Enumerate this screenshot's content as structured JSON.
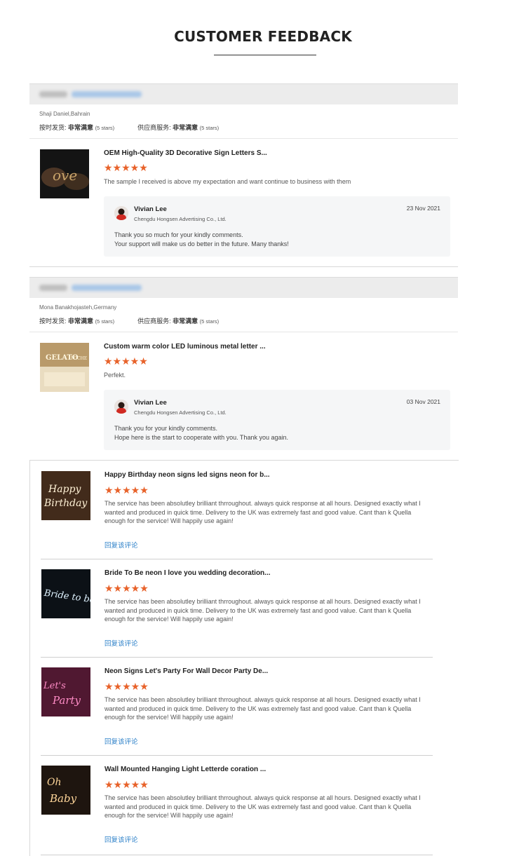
{
  "header": {
    "title": "CUSTOMER FEEDBACK"
  },
  "orders": [
    {
      "buyer": "Shaji Daniel,Bahrain",
      "delivery_label": "按时发货:",
      "delivery_value": "非常满意",
      "delivery_stars": "(5 stars)",
      "service_label": "供应商服务:",
      "service_value": "非常满意",
      "service_stars": "(5 stars)",
      "product_title": "OEM High-Quality 3D Decorative Sign Letters S...",
      "stars": "★★★★★",
      "review": "The sample I received is above my expectation and want continue to business with them",
      "reply": {
        "name": "Vivian Lee",
        "company": "Chengdu Hongsen Advertising Co., Ltd.",
        "date": "23 Nov 2021",
        "line1": "Thank you so much for your kindly comments.",
        "line2": "Your support will make us do better in the future. Many thanks!"
      }
    },
    {
      "buyer": "Mona Banakhojasteh,Germany",
      "delivery_label": "按时发货:",
      "delivery_value": "非常满意",
      "delivery_stars": "(5 stars)",
      "service_label": "供应商服务:",
      "service_value": "非常满意",
      "service_stars": "(5 stars)",
      "product_title": "Custom warm color LED luminous metal letter ...",
      "stars": "★★★★★",
      "review": "Perfekt.",
      "reply": {
        "name": "Vivian Lee",
        "company": "Chengdu Hongsen Advertising Co., Ltd.",
        "date": "03 Nov 2021",
        "line1": "Thank you for your kindly comments.",
        "line2": "Hope here is the start to cooperate with you. Thank you again."
      }
    }
  ],
  "reviews": [
    {
      "title": "Happy Birthday neon signs led signs neon for b...",
      "stars": "★★★★★",
      "text": "The service has been absolutley brilliant thrroughout. always quick response at all hours. Designed exactly what I wanted and produced in quick time. Delivery to the UK was extremely fast and good value. Cant than k Quella enough for the service! Will happily use again!",
      "reply_link": "回复该评论",
      "thumb_text": "Happy Birthday",
      "thumb_color": "#f2e6c8"
    },
    {
      "title": "Bride To Be neon I love you wedding decoration...",
      "stars": "★★★★★",
      "text": "The service has been absolutley brilliant thrroughout. always quick response at all hours. Designed exactly what I wanted and produced in quick time. Delivery to the UK was extremely fast and good value. Cant than k Quella enough for the service! Will happily use again!",
      "reply_link": "回复该评论",
      "thumb_text": "Bride to be",
      "thumb_color": "#d8f0ff"
    },
    {
      "title": "Neon Signs Let's Party For Wall Decor Party De...",
      "stars": "★★★★★",
      "text": "The service has been absolutley brilliant thrroughout. always quick response at all hours. Designed exactly what I wanted and produced in quick time. Delivery to the UK was extremely fast and good value. Cant than k Quella enough for the service! Will happily use again!",
      "reply_link": "回复该评论",
      "thumb_text": "Let's Party",
      "thumb_color": "#ff5aa5"
    },
    {
      "title": "Wall Mounted Hanging Light Letterde coration ...",
      "stars": "★★★★★",
      "text": "The service has been absolutley brilliant thrroughout. always quick response at all hours. Designed exactly what I wanted and produced in quick time. Delivery to the UK was extremely fast and good value. Cant than k Quella enough for the service! Will happily use again!",
      "reply_link": "回复该评论",
      "thumb_text": "Oh Baby",
      "thumb_color": "#f5c98a"
    }
  ],
  "colors": {
    "star": "#e8622a",
    "link": "#2f82c9",
    "bar": "#ececec"
  }
}
